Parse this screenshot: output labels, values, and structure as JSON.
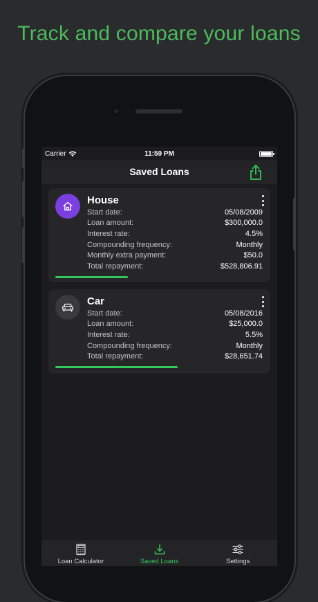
{
  "headline": "Track and compare your loans",
  "status": {
    "carrier": "Carrier",
    "time": "11:59 PM"
  },
  "nav": {
    "title": "Saved Loans"
  },
  "colors": {
    "accent": "#4cbb5c",
    "progress": "#34c759",
    "house_avatar": "#7b3fe0",
    "car_avatar": "#3a3a3c"
  },
  "loans": [
    {
      "title": "House",
      "icon": "house-icon",
      "progress": 0.35,
      "rows": [
        {
          "label": "Start date:",
          "value": "05/08/2009"
        },
        {
          "label": "Loan amount:",
          "value": "$300,000.0"
        },
        {
          "label": "Interest rate:",
          "value": "4.5%"
        },
        {
          "label": "Compounding frequency:",
          "value": "Monthly"
        },
        {
          "label": "Monthly extra payment:",
          "value": "$50.0"
        },
        {
          "label": "Total repayment:",
          "value": "$528,806.91"
        }
      ]
    },
    {
      "title": "Car",
      "icon": "car-icon",
      "progress": 0.59,
      "rows": [
        {
          "label": "Start date:",
          "value": "05/08/2016"
        },
        {
          "label": "Loan amount:",
          "value": "$25,000.0"
        },
        {
          "label": "Interest rate:",
          "value": "5.5%"
        },
        {
          "label": "Compounding frequency:",
          "value": "Monthly"
        },
        {
          "label": "Total repayment:",
          "value": "$28,651.74"
        }
      ]
    }
  ],
  "tabs": [
    {
      "label": "Loan Calculator",
      "icon": "calculator-icon",
      "active": false
    },
    {
      "label": "Saved Loans",
      "icon": "download-icon",
      "active": true
    },
    {
      "label": "Settings",
      "icon": "sliders-icon",
      "active": false
    }
  ]
}
